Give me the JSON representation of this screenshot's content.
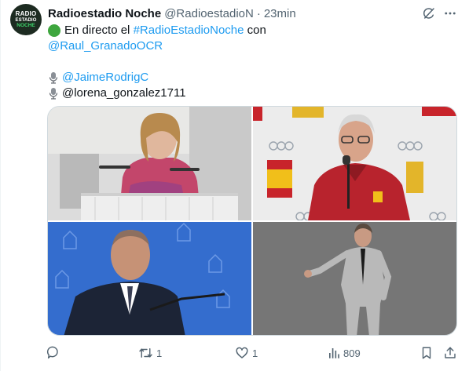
{
  "author": {
    "name": "Radioestadio Noche",
    "handle": "@RadioestadioN",
    "separator": "·",
    "time": "23min",
    "avatar_text": [
      "RADIO",
      "ESTADIO",
      "NOCHE"
    ]
  },
  "body": {
    "line1_prefix": "En directo el",
    "hashtag": "#RadioEstadioNoche",
    "line1_suffix": "con",
    "mention_host": "@Raul_GranadoOCR",
    "mention_1": "@JaimeRodrigC",
    "mention_2": "@lorena_gonzalez1711"
  },
  "actions": {
    "reply_count": "",
    "retweet_count": "1",
    "like_count": "1",
    "views_count": "809"
  },
  "icons": {
    "grok": "grok-icon",
    "more": "more-icon",
    "reply": "reply-icon",
    "retweet": "retweet-icon",
    "like": "heart-icon",
    "views": "views-icon",
    "bookmark": "bookmark-icon",
    "share": "share-icon"
  },
  "colors": {
    "link": "#1d9bf0",
    "secondary_text": "#536471",
    "primary_text": "#0f1419",
    "border": "#cfd9de",
    "live_dot": "#3ea63e"
  }
}
